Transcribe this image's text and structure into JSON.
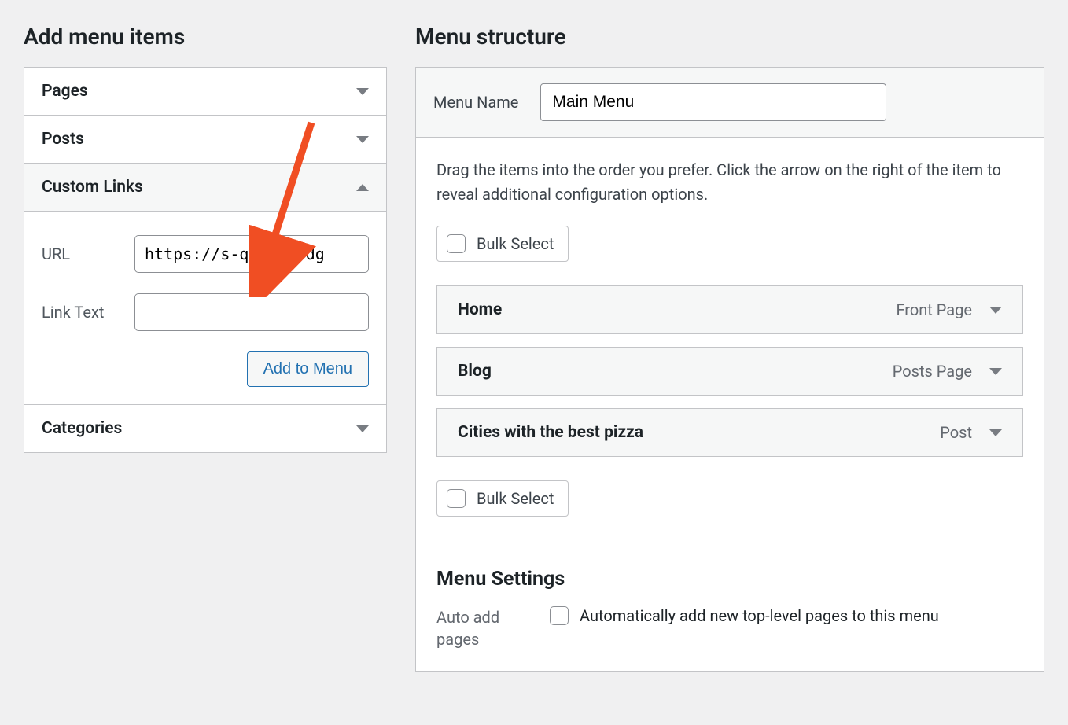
{
  "left": {
    "heading": "Add menu items",
    "accordions": {
      "pages": "Pages",
      "posts": "Posts",
      "custom_links": "Custom Links",
      "categories": "Categories"
    },
    "custom_links_form": {
      "url_label": "URL",
      "url_value": "https://s-qfbt22vdg",
      "linktext_label": "Link Text",
      "linktext_value": "",
      "add_button": "Add to Menu"
    }
  },
  "right": {
    "heading": "Menu structure",
    "menu_name_label": "Menu Name",
    "menu_name_value": "Main Menu",
    "help_text": "Drag the items into the order you prefer. Click the arrow on the right of the item to reveal additional configuration options.",
    "bulk_select_label": "Bulk Select",
    "items": [
      {
        "title": "Home",
        "type": "Front Page"
      },
      {
        "title": "Blog",
        "type": "Posts Page"
      },
      {
        "title": "Cities with the best pizza",
        "type": "Post"
      }
    ],
    "settings": {
      "heading": "Menu Settings",
      "auto_add_label": "Auto add pages",
      "auto_add_option": "Automatically add new top-level pages to this menu"
    }
  },
  "colors": {
    "accent": "#2271b1",
    "arrow": "#f04e23"
  }
}
